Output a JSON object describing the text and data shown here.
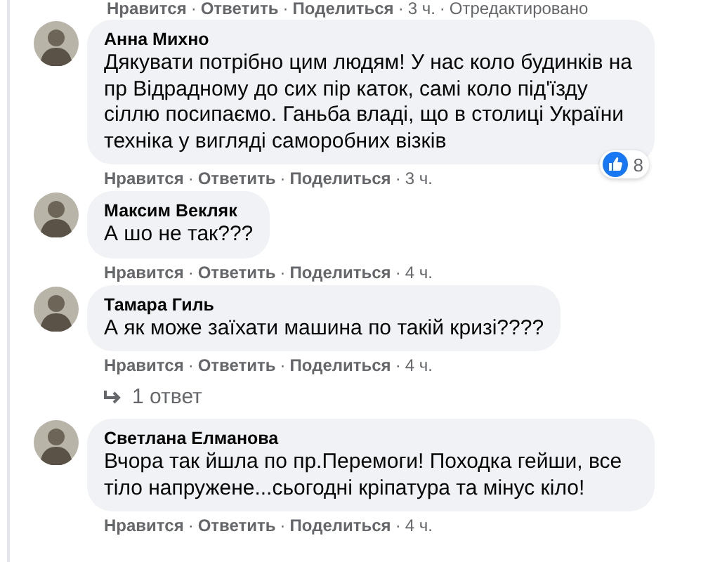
{
  "top_actions": [
    "Нравится",
    "·",
    "Ответить",
    "·",
    "Поделиться",
    "·",
    "3 ч.",
    "·",
    "Отредактировано"
  ],
  "comments": [
    {
      "author": "Анна Михно",
      "text": "Дякувати потрібно цим людям! У нас коло будинків на пр Відрадному до сих пір каток, самі коло під'їзду сіллю посипаємо. Ганьба владі, що в столиці України техніка у вигляді саморобних візків",
      "likes": "8",
      "actions": [
        "Нравится",
        "·",
        "Ответить",
        "·",
        "Поделиться",
        "·",
        "3 ч."
      ]
    },
    {
      "author": "Максим Векляк",
      "text": "А шо не так???",
      "actions": [
        "Нравится",
        "·",
        "Ответить",
        "·",
        "Поделиться",
        "·",
        "4 ч."
      ]
    },
    {
      "author": "Тамара Гиль",
      "text": "А як може заїхати машина по такій кризі????",
      "actions": [
        "Нравится",
        "·",
        "Ответить",
        "·",
        "Поделиться",
        "·",
        "4 ч."
      ],
      "replies": "1 ответ"
    },
    {
      "author": "Светлана Елманова",
      "text": "Вчора так йшла по пр.Перемоги! Походка гейши, все тіло напружене...сьогодні кріпатура та мінус кіло!",
      "actions": [
        "Нравится",
        "·",
        "Ответить",
        "·",
        "Поделиться",
        "·",
        "4 ч."
      ]
    }
  ]
}
